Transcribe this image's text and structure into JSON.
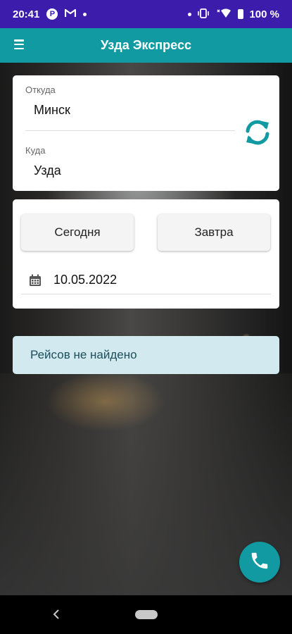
{
  "status_bar": {
    "time": "20:41",
    "battery_percent": "100 %",
    "icons": [
      "p-icon",
      "gmail-icon",
      "notification-dot",
      "dot",
      "vibrate-icon",
      "wifi-icon",
      "battery-icon"
    ]
  },
  "app_bar": {
    "title": "Узда Экспресс",
    "menu_icon": "hamburger-icon"
  },
  "route": {
    "from_label": "Откуда",
    "from_value": "Минск",
    "to_label": "Куда",
    "to_value": "Узда",
    "swap_icon": "swap-arrows-icon"
  },
  "dates": {
    "today_label": "Сегодня",
    "tomorrow_label": "Завтра",
    "selected_date": "10.05.2022",
    "calendar_icon": "calendar-icon"
  },
  "results": {
    "message": "Рейсов не найдено"
  },
  "fab": {
    "icon": "phone-icon"
  },
  "colors": {
    "status_bar": "#3c1cab",
    "accent": "#129aa2",
    "info_bg": "#d2eaef",
    "info_text": "#1c4f5b"
  }
}
